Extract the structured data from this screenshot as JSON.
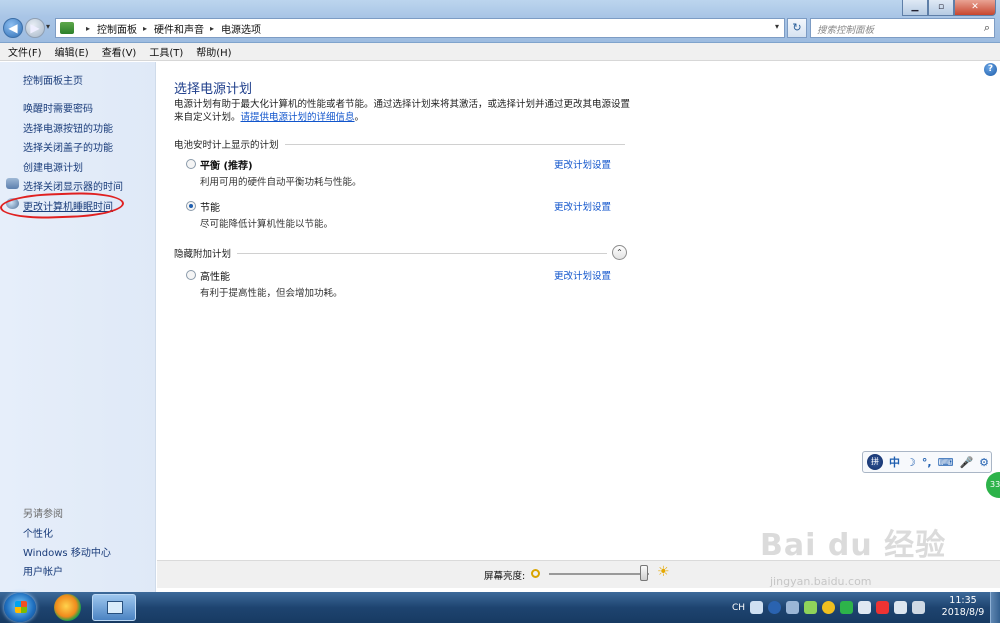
{
  "window": {
    "breadcrumb": [
      "控制面板",
      "硬件和声音",
      "电源选项"
    ],
    "search_placeholder": "搜索控制面板",
    "controls": {
      "minimize": "▁",
      "maximize": "▫",
      "close": "✕"
    }
  },
  "menubar": [
    "文件(F)",
    "编辑(E)",
    "查看(V)",
    "工具(T)",
    "帮助(H)"
  ],
  "sidebar": {
    "home": "控制面板主页",
    "links": [
      "唤醒时需要密码",
      "选择电源按钮的功能",
      "选择关闭盖子的功能",
      "创建电源计划",
      "选择关闭显示器的时间",
      "更改计算机睡眠时间"
    ],
    "see_also_title": "另请参阅",
    "see_also": [
      "个性化",
      "Windows 移动中心",
      "用户帐户"
    ]
  },
  "main": {
    "title": "选择电源计划",
    "intro": "电源计划有助于最大化计算机的性能或者节能。通过选择计划来将其激活，或选择计划并通过更改其电源设置来自定义计划。",
    "intro_link": "请提供电源计划的详细信息",
    "intro_end": "。",
    "battery_section": "电池安时计上显示的计划",
    "hidden_section": "隐藏附加计划",
    "plans": [
      {
        "name": "平衡 (推荐)",
        "desc": "利用可用的硬件自动平衡功耗与性能。",
        "link": "更改计划设置",
        "selected": false
      },
      {
        "name": "节能",
        "desc": "尽可能降低计算机性能以节能。",
        "link": "更改计划设置",
        "selected": true
      },
      {
        "name": "高性能",
        "desc": "有利于提高性能，但会增加功耗。",
        "link": "更改计划设置",
        "selected": false
      }
    ]
  },
  "brightness": {
    "label": "屏幕亮度:",
    "level_fraction": 0.95
  },
  "ime_toolbar": [
    "中",
    "☽",
    "°,",
    "⌨",
    "🎤",
    "⚙"
  ],
  "float_badge": "33",
  "watermark": {
    "main": "Bai du 经验",
    "sub": "jingyan.baidu.com"
  },
  "taskbar": {
    "tray_text": "CH",
    "clock_time": "11:35",
    "clock_date": "2018/8/9"
  },
  "colors": {
    "link": "#1155cc",
    "title": "#1d3d8a",
    "annotation_circle": "#e02020"
  }
}
